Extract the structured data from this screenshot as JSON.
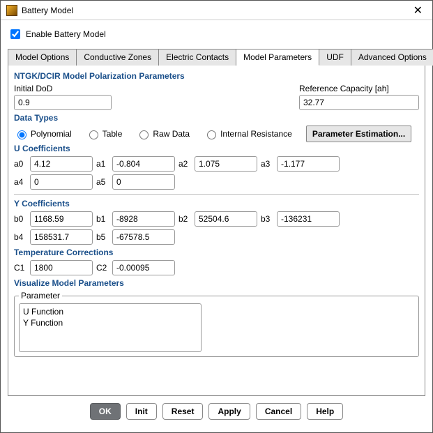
{
  "window": {
    "title": "Battery Model"
  },
  "enable": {
    "label": "Enable Battery Model",
    "checked": true
  },
  "tabs": {
    "model_options": "Model Options",
    "conductive_zones": "Conductive Zones",
    "electric_contacts": "Electric Contacts",
    "model_parameters": "Model Parameters",
    "udf": "UDF",
    "advanced_options": "Advanced Options"
  },
  "headings": {
    "polarization": "NTGK/DCIR Model Polarization Parameters",
    "data_types": "Data Types",
    "u_coeffs": "U Coefficients",
    "y_coeffs": "Y Coefficients",
    "temp_corr": "Temperature Corrections",
    "visualize": "Visualize Model Parameters"
  },
  "fields": {
    "initial_dod_label": "Initial DoD",
    "initial_dod_value": "0.9",
    "ref_cap_label": "Reference Capacity [ah]",
    "ref_cap_value": "32.77"
  },
  "data_types": {
    "polynomial": "Polynomial",
    "table": "Table",
    "raw_data": "Raw Data",
    "internal_resistance": "Internal Resistance",
    "param_est_btn": "Parameter Estimation..."
  },
  "u": {
    "a0l": "a0",
    "a0v": "4.12",
    "a1l": "a1",
    "a1v": "-0.804",
    "a2l": "a2",
    "a2v": "1.075",
    "a3l": "a3",
    "a3v": "-1.177",
    "a4l": "a4",
    "a4v": "0",
    "a5l": "a5",
    "a5v": "0"
  },
  "y": {
    "b0l": "b0",
    "b0v": "1168.59",
    "b1l": "b1",
    "b1v": "-8928",
    "b2l": "b2",
    "b2v": "52504.6",
    "b3l": "b3",
    "b3v": "-136231",
    "b4l": "b4",
    "b4v": "158531.7",
    "b5l": "b5",
    "b5v": "-67578.5"
  },
  "temp": {
    "c1l": "C1",
    "c1v": "1800",
    "c2l": "C2",
    "c2v": "-0.00095"
  },
  "visualize": {
    "legend": "Parameter",
    "items": [
      "U Function",
      "Y Function"
    ]
  },
  "buttons": {
    "ok": "OK",
    "init": "Init",
    "reset": "Reset",
    "apply": "Apply",
    "cancel": "Cancel",
    "help": "Help"
  }
}
